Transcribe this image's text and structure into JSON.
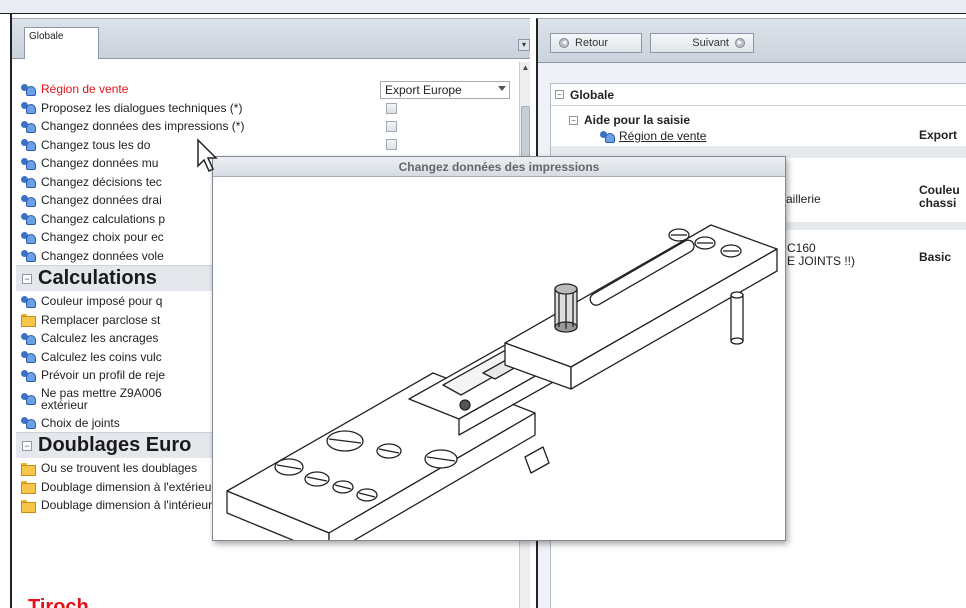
{
  "left_panel": {
    "tab_label": "Globale",
    "rows": [
      {
        "label": "Région de vente",
        "icon": "user-settings-icon"
      },
      {
        "label": "Proposez les dialogues techniques (*)",
        "icon": "user-settings-icon"
      },
      {
        "label": "Changez données des impressions (*)",
        "icon": "user-settings-icon"
      },
      {
        "label": "Changez tous les do",
        "icon": "user-settings-icon"
      },
      {
        "label": "Changez données mu",
        "icon": "user-settings-icon"
      },
      {
        "label": "Changez décisions tec",
        "icon": "user-settings-icon"
      },
      {
        "label": "Changez données drai",
        "icon": "user-settings-icon"
      },
      {
        "label": "Changez calculations p",
        "icon": "user-settings-icon"
      },
      {
        "label": "Changez choix pour ec",
        "icon": "user-settings-icon"
      },
      {
        "label": "Changez données vole",
        "icon": "user-settings-icon"
      }
    ],
    "region_value": "Export Europe",
    "section_calculations": "Calculations",
    "calc_rows": [
      {
        "label": "Couleur imposé pour q",
        "icon": "user-settings-icon"
      },
      {
        "label": "Remplacer parclose st",
        "icon": "folder-settings-icon"
      },
      {
        "label": "Calculez les ancrages",
        "icon": "user-settings-icon"
      },
      {
        "label": "Calculez les coins vulc",
        "icon": "user-settings-icon"
      },
      {
        "label": "Prévoir un profil de reje",
        "icon": "user-settings-icon"
      },
      {
        "label": "Ne pas mettre Z9A006",
        "label2": "extérieur",
        "icon": "user-settings-icon"
      },
      {
        "label": "Choix de joints",
        "icon": "user-settings-icon"
      }
    ],
    "section_doublages": "Doublages Euro",
    "doub_rows": [
      {
        "label": "Ou se trouvent les doublages",
        "icon": "folder-settings-icon"
      },
      {
        "label": "Doublage dimension à l'extérieur",
        "icon": "folder-settings-icon"
      },
      {
        "label": "Doublage dimension à l'intérieur",
        "icon": "folder-settings-icon"
      }
    ],
    "bottom_text": "Tiroch..."
  },
  "right_panel": {
    "back_label": "Retour",
    "next_label": "Suivant",
    "group_title": "Globale",
    "subgroup_title": "Aide pour la saisie",
    "region_label": "Région de vente",
    "region_value": "Export",
    "row2_label": "aillerie",
    "row2_value_line1": "Couleu",
    "row2_value_line2": "chassi",
    "row3_label_line1": "C160",
    "row3_label_line2": "E JOINTS !!)",
    "row3_value": "Basic"
  },
  "popup": {
    "title": "Changez données des impressions"
  }
}
